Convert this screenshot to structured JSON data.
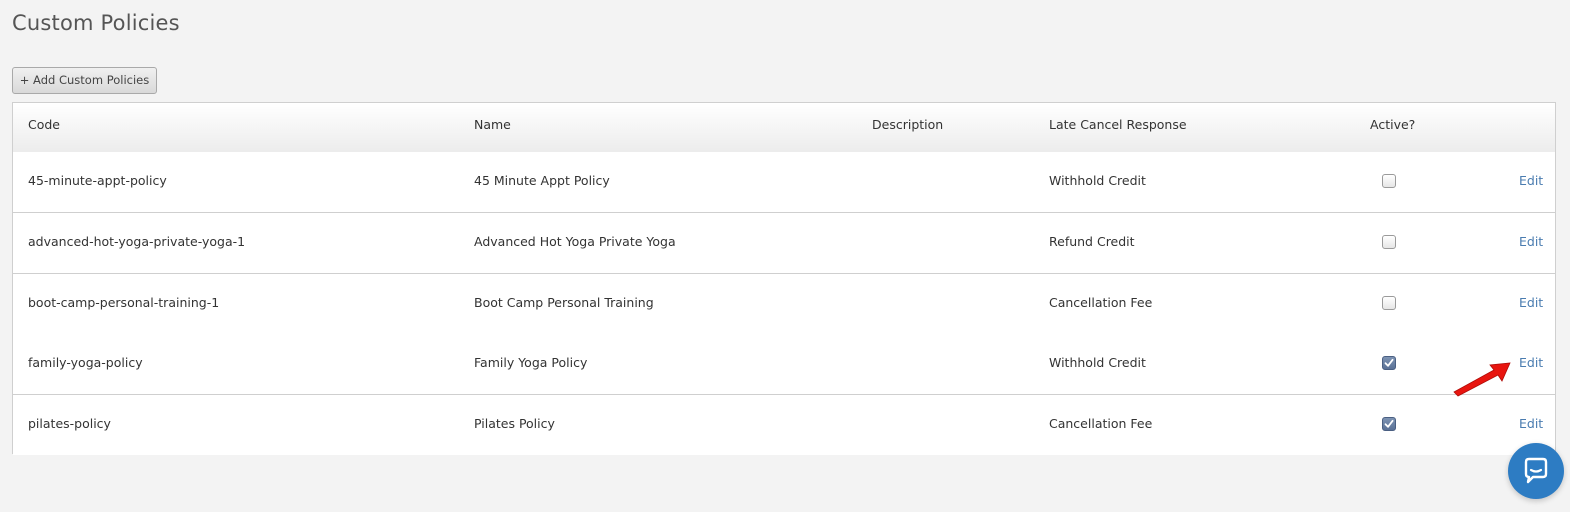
{
  "page": {
    "title": "Custom Policies"
  },
  "toolbar": {
    "add_label": "+ Add Custom Policies"
  },
  "table": {
    "columns": {
      "code": "Code",
      "name": "Name",
      "description": "Description",
      "late_cancel": "Late Cancel Response",
      "active": "Active?"
    },
    "rows": [
      {
        "code": "45-minute-appt-policy",
        "name": "45 Minute Appt Policy",
        "description": "",
        "late_cancel": "Withhold Credit",
        "active": false,
        "action": "Edit"
      },
      {
        "code": "advanced-hot-yoga-private-yoga-1",
        "name": "Advanced Hot Yoga Private Yoga",
        "description": "",
        "late_cancel": "Refund Credit",
        "active": false,
        "action": "Edit"
      },
      {
        "code": "boot-camp-personal-training-1",
        "name": "Boot Camp Personal Training",
        "description": "",
        "late_cancel": "Cancellation Fee",
        "active": false,
        "action": "Edit"
      },
      {
        "code": "family-yoga-policy",
        "name": "Family Yoga Policy",
        "description": "",
        "late_cancel": "Withhold Credit",
        "active": true,
        "action": "Edit"
      },
      {
        "code": "pilates-policy",
        "name": "Pilates Policy",
        "description": "",
        "late_cancel": "Cancellation Fee",
        "active": true,
        "action": "Edit"
      }
    ]
  },
  "annotation": {
    "arrow_color": "#e8150f"
  },
  "chat": {
    "icon": "chat-bubble-icon",
    "color": "#2d7cc3"
  },
  "colors": {
    "link": "#4a7cb0",
    "checkbox_checked": "#5a7196"
  }
}
